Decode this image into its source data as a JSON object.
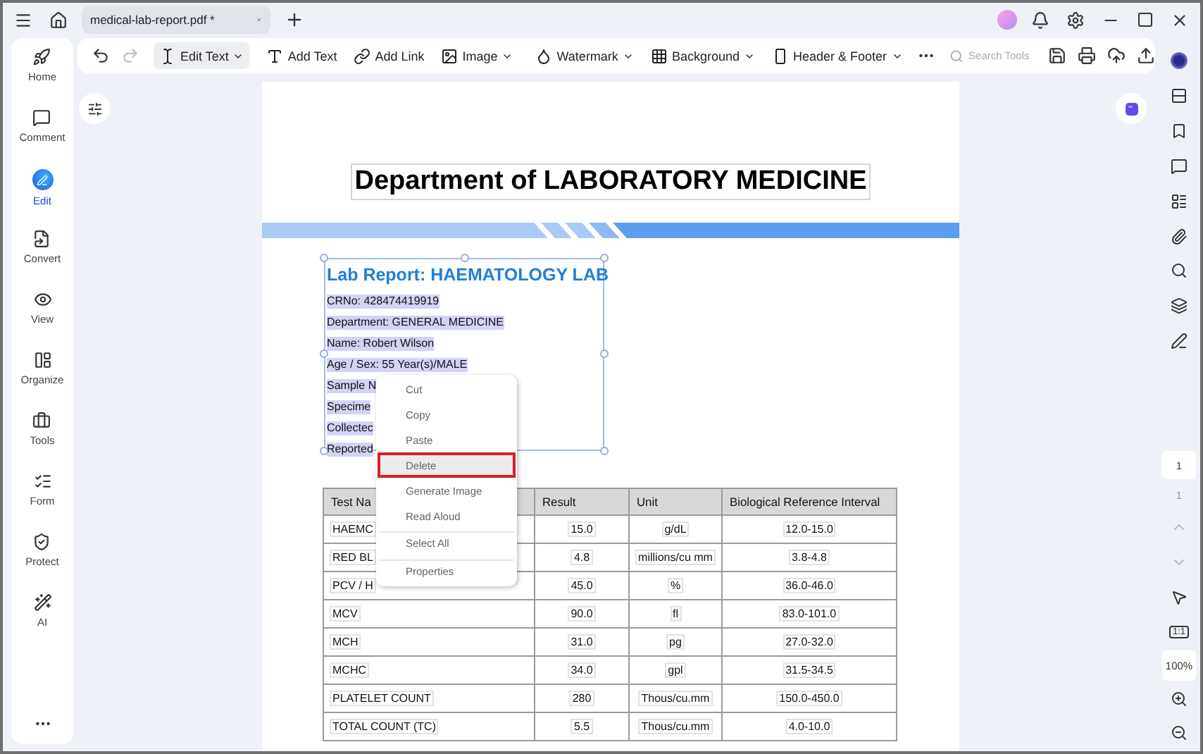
{
  "window": {
    "tab_title": "medical-lab-report.pdf *"
  },
  "toolbar": {
    "items": [
      {
        "label": "Edit Text",
        "dropdown": true,
        "selected": true
      },
      {
        "label": "Add Text",
        "dropdown": false,
        "selected": false
      },
      {
        "label": "Add Link",
        "dropdown": false,
        "selected": false
      },
      {
        "label": "Image",
        "dropdown": true,
        "selected": false
      },
      {
        "label": "Watermark",
        "dropdown": true,
        "selected": false
      },
      {
        "label": "Background",
        "dropdown": true,
        "selected": false
      },
      {
        "label": "Header & Footer",
        "dropdown": true,
        "selected": false
      }
    ],
    "search": {
      "placeholder": "Search Tools"
    }
  },
  "sidebar": {
    "items": [
      {
        "label": "Home",
        "selected": false
      },
      {
        "label": "Comment",
        "selected": false
      },
      {
        "label": "Edit",
        "selected": true
      },
      {
        "label": "Convert",
        "selected": false
      },
      {
        "label": "View",
        "selected": false
      },
      {
        "label": "Organize",
        "selected": false
      },
      {
        "label": "Tools",
        "selected": false
      },
      {
        "label": "Form",
        "selected": false
      },
      {
        "label": "Protect",
        "selected": false
      },
      {
        "label": "AI",
        "selected": false
      }
    ]
  },
  "document": {
    "heading": "Department of LABORATORY MEDICINE",
    "section_title": "Lab Report: HAEMATOLOGY LAB",
    "fields": [
      "CRNo: 428474419919",
      "Department: GENERAL MEDICINE",
      "Name: Robert Wilson",
      "Age / Sex: 55 Year(s)/MALE",
      "Sample N",
      "Specime",
      "Collectec",
      "Reported"
    ],
    "table": {
      "columns": [
        "Test Na",
        "Result",
        "Unit",
        "Biological Reference Interval"
      ],
      "rows": [
        [
          "HAEMC",
          "15.0",
          "g/dL",
          "12.0-15.0"
        ],
        [
          "RED BL",
          "4.8",
          "millions/cu mm",
          "3.8-4.8"
        ],
        [
          "PCV / H",
          "45.0",
          "%",
          "36.0-46.0"
        ],
        [
          "MCV",
          "90.0",
          "fl",
          "83.0-101.0"
        ],
        [
          "MCH",
          "31.0",
          "pg",
          "27.0-32.0"
        ],
        [
          "MCHC",
          "34.0",
          "gpl",
          "31.5-34.5"
        ],
        [
          "PLATELET COUNT",
          "280",
          "Thous/cu.mm",
          "150.0-450.0"
        ],
        [
          "TOTAL COUNT (TC)",
          "5.5",
          "Thous/cu.mm",
          "4.0-10.0"
        ]
      ]
    }
  },
  "context_menu": {
    "items": [
      {
        "label": "Cut",
        "highlighted": false,
        "separator_before": false
      },
      {
        "label": "Copy",
        "highlighted": false,
        "separator_before": false
      },
      {
        "label": "Paste",
        "highlighted": false,
        "separator_before": false
      },
      {
        "label": "Delete",
        "highlighted": true,
        "separator_before": false
      },
      {
        "label": "Generate Image",
        "highlighted": false,
        "separator_before": false
      },
      {
        "label": "Read Aloud",
        "highlighted": false,
        "separator_before": false
      },
      {
        "label": "Select All",
        "highlighted": false,
        "separator_before": true
      },
      {
        "label": "Properties",
        "highlighted": false,
        "separator_before": true
      }
    ]
  },
  "page_nav": {
    "current": "1",
    "total": "1"
  },
  "view_controls": {
    "actual_size": "1:1",
    "zoom": "100%"
  }
}
